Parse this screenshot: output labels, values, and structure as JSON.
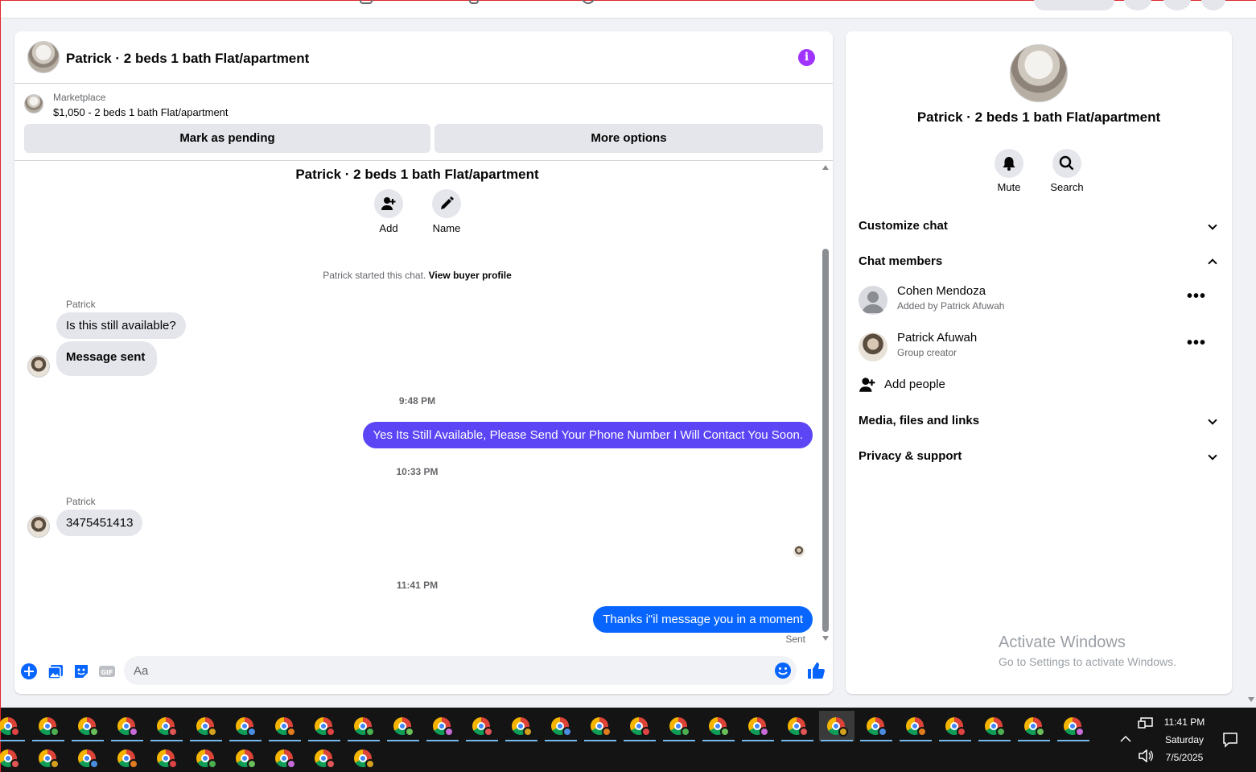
{
  "chat": {
    "title": "Patrick · 2 beds 1 bath Flat/apartment",
    "marketplace_label": "Marketplace",
    "listing": "$1,050 - 2 beds 1 bath Flat/apartment",
    "mark_pending": "Mark as pending",
    "more_options": "More options",
    "thread_title": "Patrick · 2 beds 1 bath Flat/apartment",
    "add_label": "Add",
    "name_label": "Name",
    "started_text": "Patrick started this chat.",
    "view_buyer": "View buyer profile",
    "messages": [
      {
        "sender": "Patrick",
        "text": "Is this still available?"
      },
      {
        "text": "Message sent"
      },
      {
        "timestamp": "9:48 PM"
      },
      {
        "text": "Yes Its Still Available, Please Send Your Phone Number I Will Contact You Soon."
      },
      {
        "timestamp": "10:33 PM"
      },
      {
        "sender": "Patrick",
        "text": "3475451413"
      },
      {
        "timestamp": "11:41 PM"
      },
      {
        "text": "Thanks i\"il message you in a moment"
      }
    ],
    "sent_status": "Sent",
    "input_placeholder": "Aa",
    "colors": {
      "outgoing1": "#5b45f5",
      "outgoing2": "#0866ff",
      "accent": "#0866ff",
      "info": "#a033ff"
    }
  },
  "info": {
    "title": "Patrick · 2 beds 1 bath Flat/apartment",
    "mute": "Mute",
    "search": "Search",
    "sections": {
      "customize": "Customize chat",
      "members": "Chat members",
      "media": "Media, files and links",
      "privacy": "Privacy & support"
    },
    "members": [
      {
        "name": "Cohen Mendoza",
        "sub": "Added by Patrick Afuwah"
      },
      {
        "name": "Patrick Afuwah",
        "sub": "Group creator"
      }
    ],
    "add_people": "Add people",
    "activate_title": "Activate Windows",
    "activate_sub": "Go to Settings to activate Windows."
  },
  "taskbar": {
    "time": "11:41 PM",
    "day": "Saturday",
    "date": "7/5/2025"
  }
}
